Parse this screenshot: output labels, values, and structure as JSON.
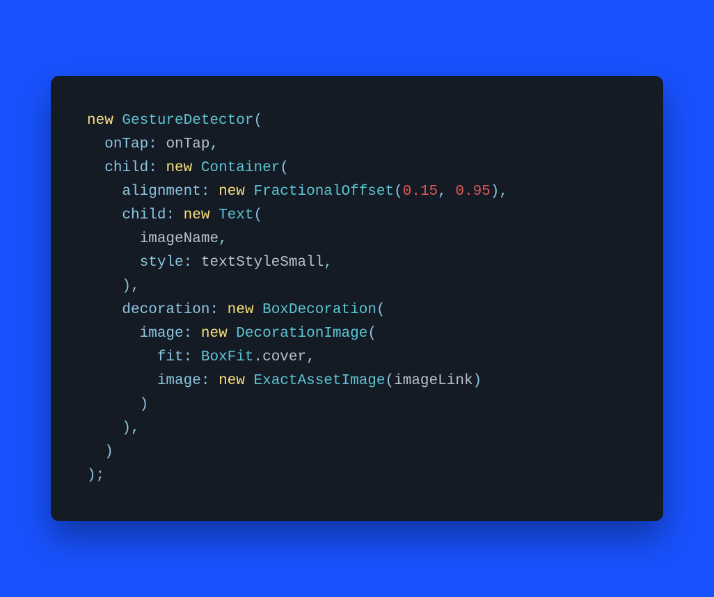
{
  "colors": {
    "bg_outer": "#1852fd",
    "bg_card": "#151b24",
    "keyword": "#f7e07c",
    "class": "#5cc5d4",
    "param": "#8bc6e0",
    "punctuation": "#8bc6e0",
    "number": "#e15656",
    "identifier": "#b7c0cc"
  },
  "code": {
    "lines": [
      {
        "indent": 0,
        "tokens": [
          {
            "t": "keyword",
            "v": "new"
          },
          {
            "t": "space",
            "v": " "
          },
          {
            "t": "class",
            "v": "GestureDetector"
          },
          {
            "t": "punc",
            "v": "("
          }
        ]
      },
      {
        "indent": 1,
        "tokens": [
          {
            "t": "param",
            "v": "onTap"
          },
          {
            "t": "punc",
            "v": ":"
          },
          {
            "t": "space",
            "v": " "
          },
          {
            "t": "ident",
            "v": "onTap"
          },
          {
            "t": "punc",
            "v": ","
          }
        ]
      },
      {
        "indent": 1,
        "tokens": [
          {
            "t": "param",
            "v": "child"
          },
          {
            "t": "punc",
            "v": ":"
          },
          {
            "t": "space",
            "v": " "
          },
          {
            "t": "keyword",
            "v": "new"
          },
          {
            "t": "space",
            "v": " "
          },
          {
            "t": "class",
            "v": "Container"
          },
          {
            "t": "punc",
            "v": "("
          }
        ]
      },
      {
        "indent": 2,
        "tokens": [
          {
            "t": "param",
            "v": "alignment"
          },
          {
            "t": "punc",
            "v": ":"
          },
          {
            "t": "space",
            "v": " "
          },
          {
            "t": "keyword",
            "v": "new"
          },
          {
            "t": "space",
            "v": " "
          },
          {
            "t": "class",
            "v": "FractionalOffset"
          },
          {
            "t": "punc",
            "v": "("
          },
          {
            "t": "number",
            "v": "0.15"
          },
          {
            "t": "punc",
            "v": ","
          },
          {
            "t": "space",
            "v": " "
          },
          {
            "t": "number",
            "v": "0.95"
          },
          {
            "t": "punc",
            "v": ")"
          },
          {
            "t": "punc",
            "v": ","
          }
        ]
      },
      {
        "indent": 2,
        "tokens": [
          {
            "t": "param",
            "v": "child"
          },
          {
            "t": "punc",
            "v": ":"
          },
          {
            "t": "space",
            "v": " "
          },
          {
            "t": "keyword",
            "v": "new"
          },
          {
            "t": "space",
            "v": " "
          },
          {
            "t": "class",
            "v": "Text"
          },
          {
            "t": "punc",
            "v": "("
          }
        ]
      },
      {
        "indent": 3,
        "tokens": [
          {
            "t": "ident",
            "v": "imageName"
          },
          {
            "t": "punc",
            "v": ","
          }
        ]
      },
      {
        "indent": 3,
        "tokens": [
          {
            "t": "param",
            "v": "style"
          },
          {
            "t": "punc",
            "v": ":"
          },
          {
            "t": "space",
            "v": " "
          },
          {
            "t": "ident",
            "v": "textStyleSmall"
          },
          {
            "t": "punc",
            "v": ","
          }
        ]
      },
      {
        "indent": 2,
        "tokens": [
          {
            "t": "punc",
            "v": ")"
          },
          {
            "t": "punc",
            "v": ","
          }
        ]
      },
      {
        "indent": 2,
        "tokens": [
          {
            "t": "param",
            "v": "decoration"
          },
          {
            "t": "punc",
            "v": ":"
          },
          {
            "t": "space",
            "v": " "
          },
          {
            "t": "keyword",
            "v": "new"
          },
          {
            "t": "space",
            "v": " "
          },
          {
            "t": "class",
            "v": "BoxDecoration"
          },
          {
            "t": "punc",
            "v": "("
          }
        ]
      },
      {
        "indent": 3,
        "tokens": [
          {
            "t": "param",
            "v": "image"
          },
          {
            "t": "punc",
            "v": ":"
          },
          {
            "t": "space",
            "v": " "
          },
          {
            "t": "keyword",
            "v": "new"
          },
          {
            "t": "space",
            "v": " "
          },
          {
            "t": "class",
            "v": "DecorationImage"
          },
          {
            "t": "punc",
            "v": "("
          }
        ]
      },
      {
        "indent": 4,
        "tokens": [
          {
            "t": "param",
            "v": "fit"
          },
          {
            "t": "punc",
            "v": ":"
          },
          {
            "t": "space",
            "v": " "
          },
          {
            "t": "class",
            "v": "BoxFit"
          },
          {
            "t": "dot",
            "v": "."
          },
          {
            "t": "ident",
            "v": "cover"
          },
          {
            "t": "punc",
            "v": ","
          }
        ]
      },
      {
        "indent": 4,
        "tokens": [
          {
            "t": "param",
            "v": "image"
          },
          {
            "t": "punc",
            "v": ":"
          },
          {
            "t": "space",
            "v": " "
          },
          {
            "t": "keyword",
            "v": "new"
          },
          {
            "t": "space",
            "v": " "
          },
          {
            "t": "class",
            "v": "ExactAssetImage"
          },
          {
            "t": "punc",
            "v": "("
          },
          {
            "t": "ident",
            "v": "imageLink"
          },
          {
            "t": "punc",
            "v": ")"
          }
        ]
      },
      {
        "indent": 3,
        "tokens": [
          {
            "t": "punc",
            "v": ")"
          }
        ]
      },
      {
        "indent": 2,
        "tokens": [
          {
            "t": "punc",
            "v": ")"
          },
          {
            "t": "punc",
            "v": ","
          }
        ]
      },
      {
        "indent": 1,
        "tokens": [
          {
            "t": "punc",
            "v": ")"
          }
        ]
      },
      {
        "indent": 0,
        "tokens": [
          {
            "t": "punc",
            "v": ")"
          },
          {
            "t": "punc",
            "v": ";"
          }
        ]
      }
    ],
    "indent_unit": "  "
  }
}
